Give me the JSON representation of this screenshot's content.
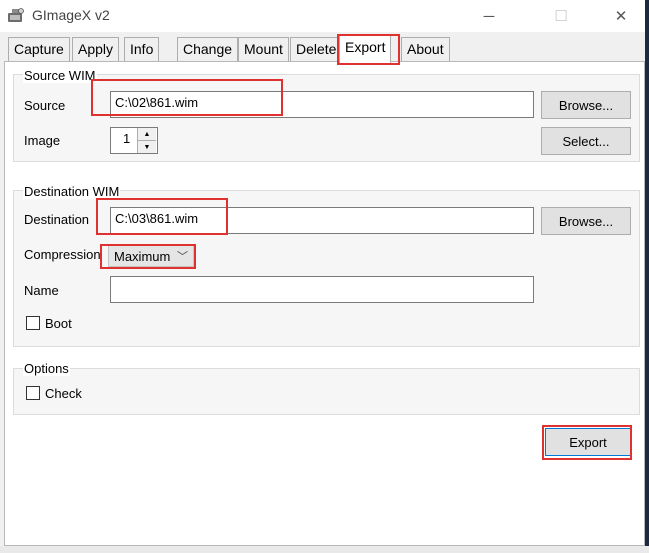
{
  "window": {
    "title": "GImageX v2",
    "app_icon": "gimagex-app-icon",
    "controls": {
      "minimize": "─",
      "maximize": "☐",
      "close": "✕"
    }
  },
  "tabs": [
    {
      "label": "Capture"
    },
    {
      "label": "Apply"
    },
    {
      "label": "Info"
    },
    {
      "label": "Change"
    },
    {
      "label": "Mount"
    },
    {
      "label": "Delete"
    },
    {
      "label": "Export",
      "active": true
    },
    {
      "label": "About"
    }
  ],
  "source_wim": {
    "group_label": "Source WIM",
    "source_label": "Source",
    "source_value": "C:\\02\\861.wim",
    "browse_label": "Browse...",
    "image_label": "Image",
    "image_value": "1",
    "select_label": "Select..."
  },
  "destination_wim": {
    "group_label": "Destination WIM",
    "destination_label": "Destination",
    "destination_value": "C:\\03\\861.wim",
    "browse_label": "Browse...",
    "compression_label": "Compression",
    "compression_value": "Maximum",
    "name_label": "Name",
    "name_value": "",
    "boot_label": "Boot"
  },
  "options": {
    "group_label": "Options",
    "check_label": "Check"
  },
  "export_button_label": "Export",
  "colors": {
    "highlight": "#e03131",
    "tab_page": "#ffffff",
    "window_bg": "#f0f0f0"
  }
}
